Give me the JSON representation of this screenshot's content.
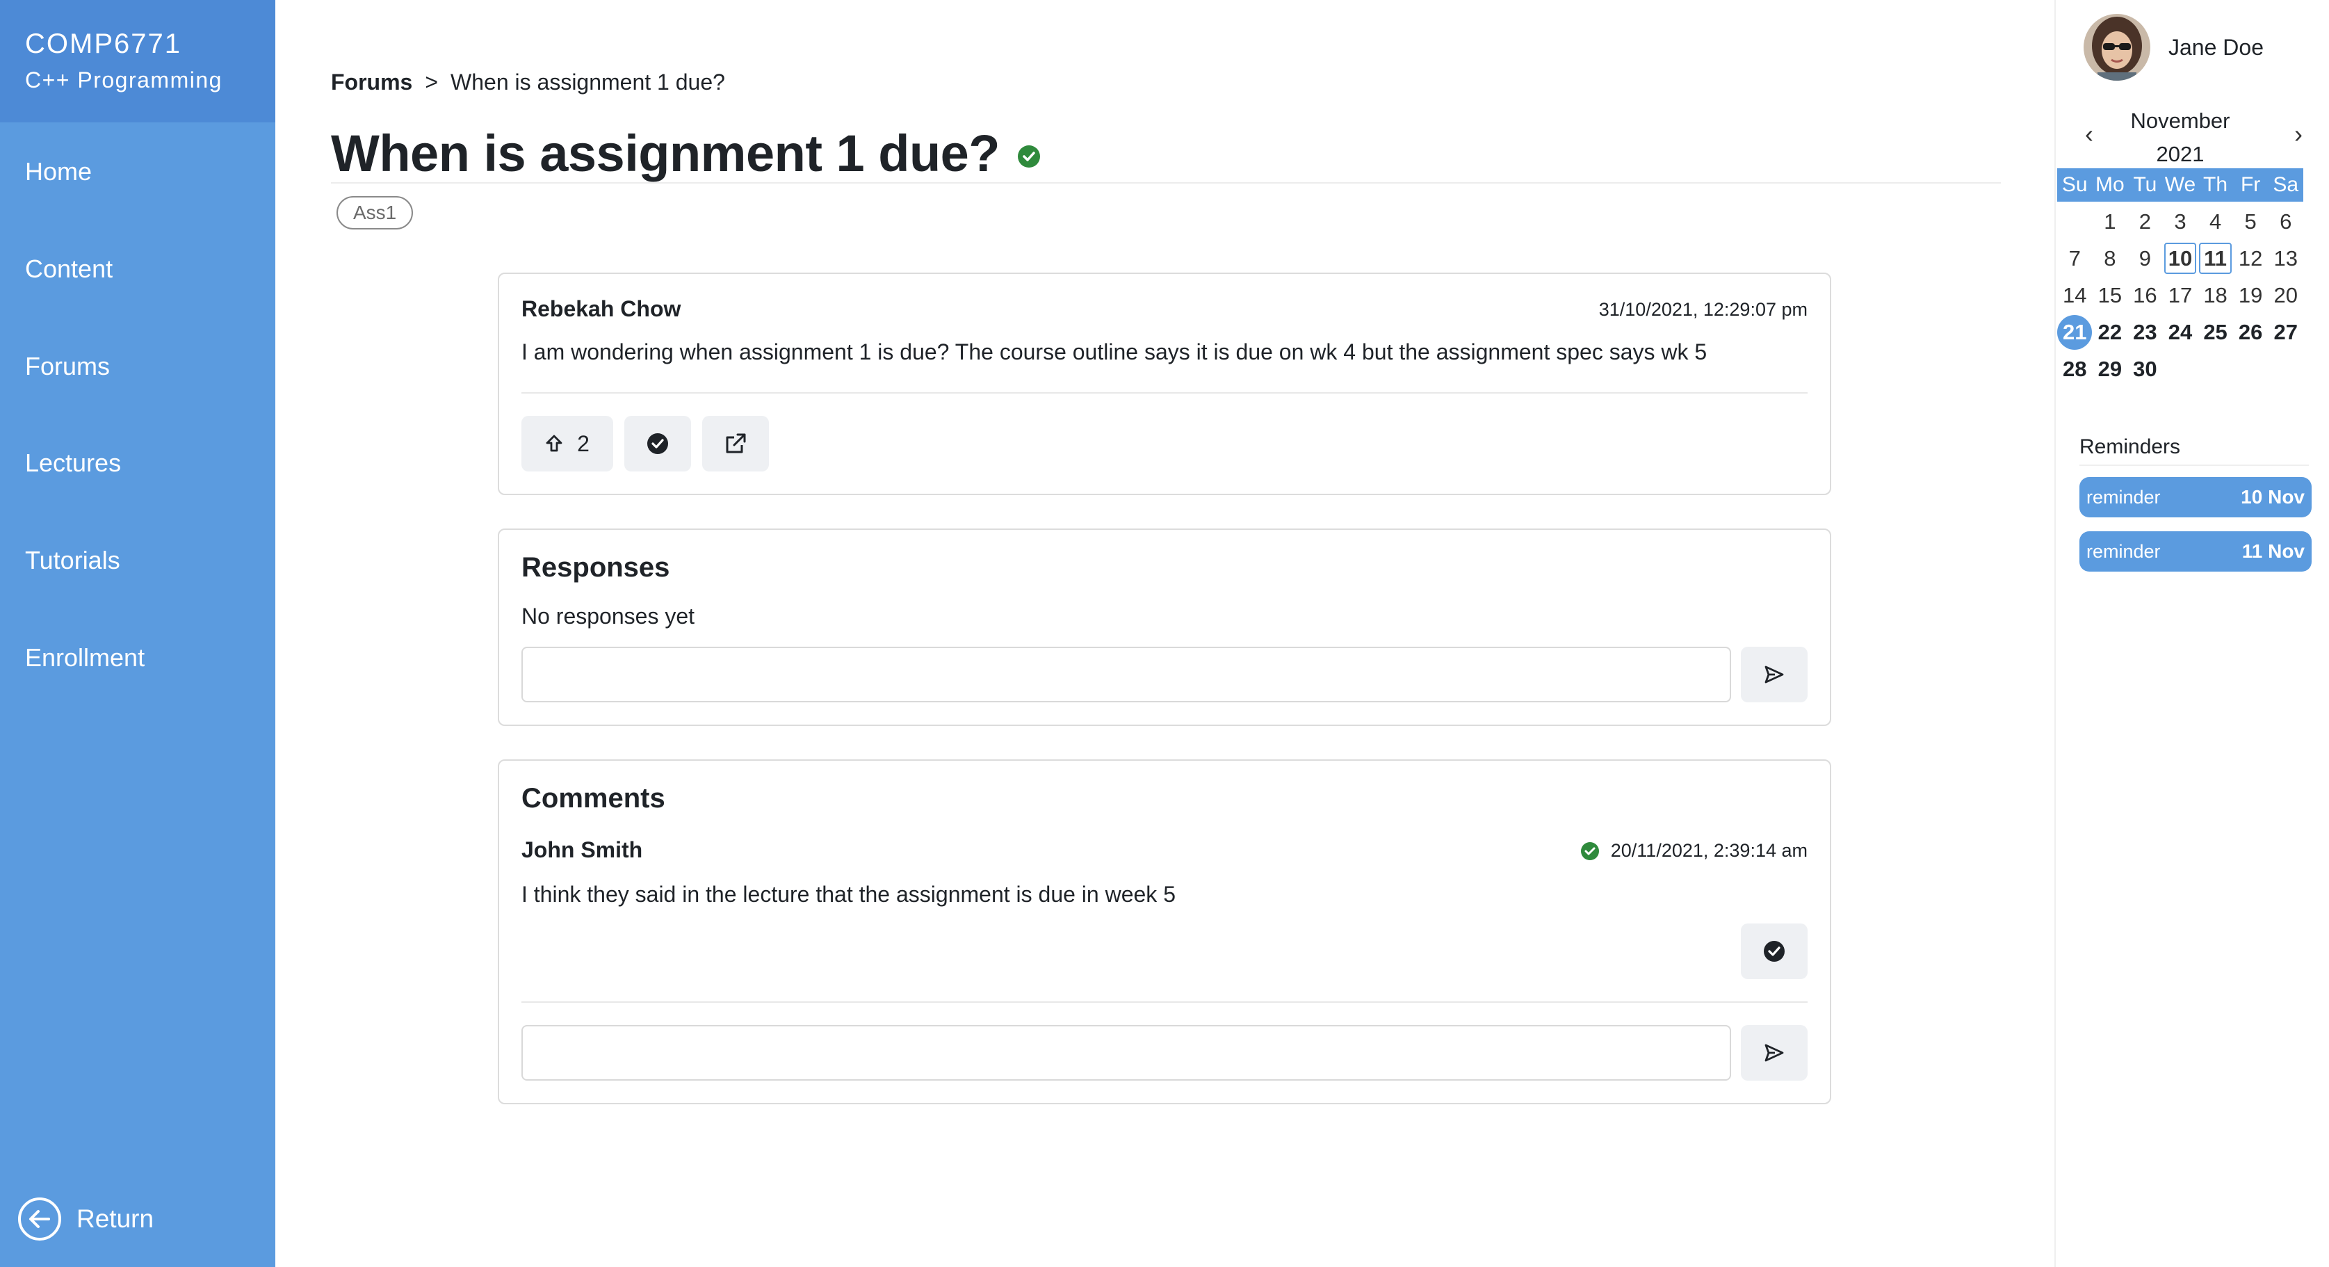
{
  "sidebar": {
    "course_code": "COMP6771",
    "course_name": "C++ Programming",
    "nav": [
      "Home",
      "Content",
      "Forums",
      "Lectures",
      "Tutorials",
      "Enrollment"
    ],
    "return_label": "Return"
  },
  "breadcrumb": {
    "parent": "Forums",
    "separator": ">",
    "current": "When is assignment 1 due?"
  },
  "post": {
    "title": "When is assignment 1 due?",
    "tag": "Ass1",
    "author": "Rebekah Chow",
    "timestamp": "31/10/2021, 12:29:07 pm",
    "body": "I am wondering when assignment 1 is due? The course outline says it is due on wk 4 but the assignment spec says wk 5",
    "upvotes": "2"
  },
  "responses": {
    "title": "Responses",
    "empty_text": "No responses yet",
    "input_placeholder": ""
  },
  "comments": {
    "title": "Comments",
    "items": [
      {
        "author": "John Smith",
        "timestamp": "20/11/2021, 2:39:14 am",
        "body": "I think they said in the lecture that the assignment is due in week 5"
      }
    ],
    "input_placeholder": ""
  },
  "user": {
    "name": "Jane Doe"
  },
  "calendar": {
    "month": "November",
    "year": "2021",
    "weekdays": [
      "Su",
      "Mo",
      "Tu",
      "We",
      "Th",
      "Fr",
      "Sa"
    ],
    "today": 21,
    "boxed_days": [
      10,
      11
    ]
  },
  "reminders": {
    "title": "Reminders",
    "items": [
      {
        "label": "reminder",
        "date": "10 Nov"
      },
      {
        "label": "reminder",
        "date": "11 Nov"
      }
    ]
  },
  "colors": {
    "sidebar": "#5b9bdf",
    "sidebar_header": "#4d8ad6",
    "accent_green": "#2f8a3c"
  }
}
